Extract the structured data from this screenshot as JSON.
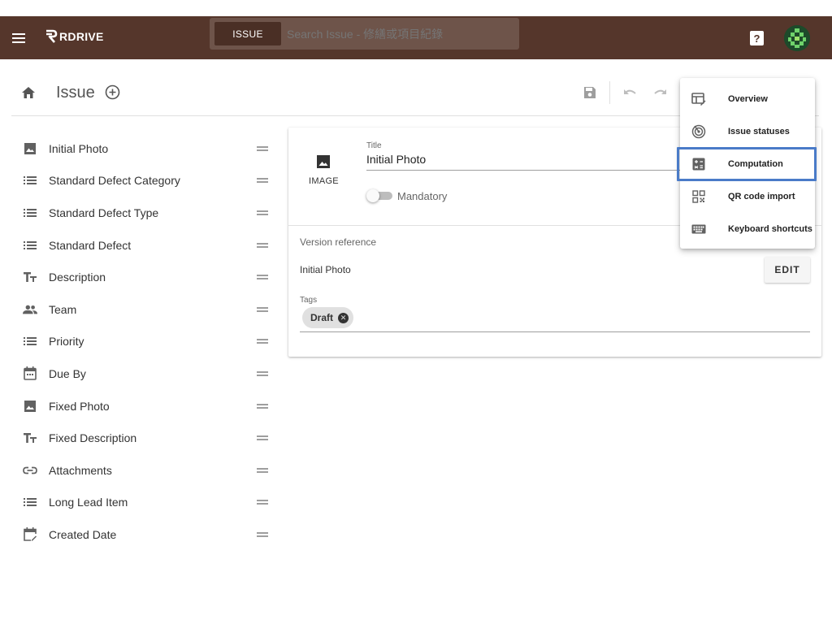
{
  "appbar": {
    "logo_text": "RDRIVE",
    "search_chip": "ISSUE",
    "search_placeholder": "Search Issue - 修繕或項目紀錄",
    "help_label": "?",
    "background": "#55362b"
  },
  "toolbar": {
    "title": "Issue"
  },
  "sidebar": {
    "items": [
      {
        "label": "Initial Photo",
        "icon": "image-icon"
      },
      {
        "label": "Standard Defect Category",
        "icon": "list-icon"
      },
      {
        "label": "Standard Defect Type",
        "icon": "list-icon"
      },
      {
        "label": "Standard Defect",
        "icon": "list-icon"
      },
      {
        "label": "Description",
        "icon": "text-fields-icon"
      },
      {
        "label": "Team",
        "icon": "people-icon"
      },
      {
        "label": "Priority",
        "icon": "list-icon"
      },
      {
        "label": "Due By",
        "icon": "calendar-icon"
      },
      {
        "label": "Fixed Photo",
        "icon": "image-icon"
      },
      {
        "label": "Fixed Description",
        "icon": "text-fields-icon"
      },
      {
        "label": "Attachments",
        "icon": "link-icon"
      },
      {
        "label": "Long Lead Item",
        "icon": "list-icon"
      },
      {
        "label": "Created Date",
        "icon": "event-edit-icon"
      }
    ]
  },
  "card": {
    "type_label": "IMAGE",
    "title_caption": "Title",
    "title_value": "Initial Photo",
    "mandatory_label": "Mandatory",
    "version_reference_label": "Version reference",
    "version_name": "Initial Photo",
    "edit_label": "EDIT",
    "tags_caption": "Tags",
    "tags": [
      "Draft"
    ]
  },
  "menu": {
    "items": [
      {
        "label": "Overview",
        "icon": "overview-icon"
      },
      {
        "label": "Issue statuses",
        "icon": "statuses-icon"
      },
      {
        "label": "Computation",
        "icon": "calculate-icon"
      },
      {
        "label": "QR code import",
        "icon": "qr-code-icon"
      },
      {
        "label": "Keyboard shortcuts",
        "icon": "keyboard-icon"
      }
    ],
    "highlighted": "Computation",
    "highlight_color": "#4a7bc8"
  }
}
